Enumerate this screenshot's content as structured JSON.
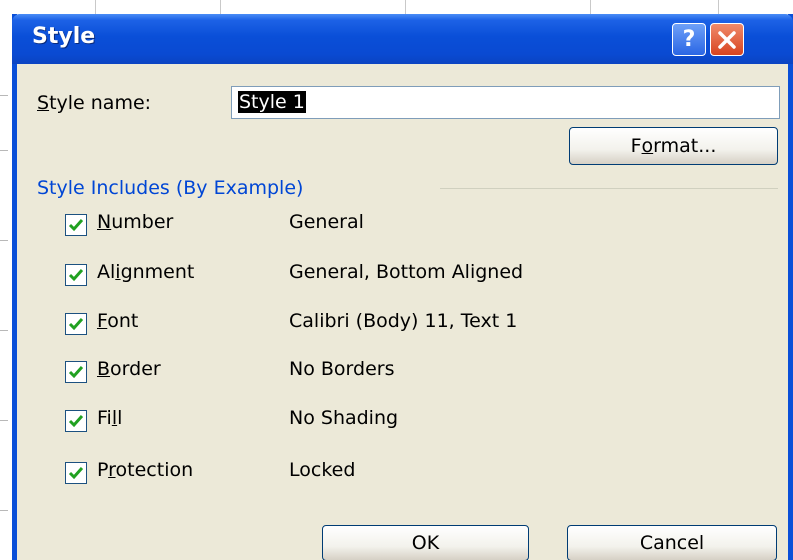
{
  "dialog": {
    "title": "Style",
    "help_glyph": "?",
    "close_glyph": "X"
  },
  "style_name": {
    "label_mnemonic": "S",
    "label_rest": "tyle name:",
    "value": "Style 1"
  },
  "buttons": {
    "format_pre": "F",
    "format_mnemonic": "o",
    "format_post": "rmat...",
    "ok": "OK",
    "cancel": "Cancel"
  },
  "includes": {
    "title": "Style Includes (By Example)",
    "items": [
      {
        "pre": "",
        "mnemonic": "N",
        "post": "umber",
        "value": "General",
        "checked": true
      },
      {
        "pre": "Al",
        "mnemonic": "i",
        "post": "gnment",
        "value": "General, Bottom Aligned",
        "checked": true
      },
      {
        "pre": "",
        "mnemonic": "F",
        "post": "ont",
        "value": "Calibri (Body) 11, Text 1",
        "checked": true
      },
      {
        "pre": "",
        "mnemonic": "B",
        "post": "order",
        "value": "No Borders",
        "checked": true
      },
      {
        "pre": "Fi",
        "mnemonic": "l",
        "post": "l",
        "value": "No Shading",
        "checked": true
      },
      {
        "pre": "P",
        "mnemonic": "r",
        "post": "otection",
        "value": "Locked",
        "checked": true
      }
    ]
  },
  "colors": {
    "titlebar": "#0a4fd8",
    "dialog_bg": "#ece9d8",
    "group_title": "#0046d5",
    "checkmark": "#21a121"
  }
}
